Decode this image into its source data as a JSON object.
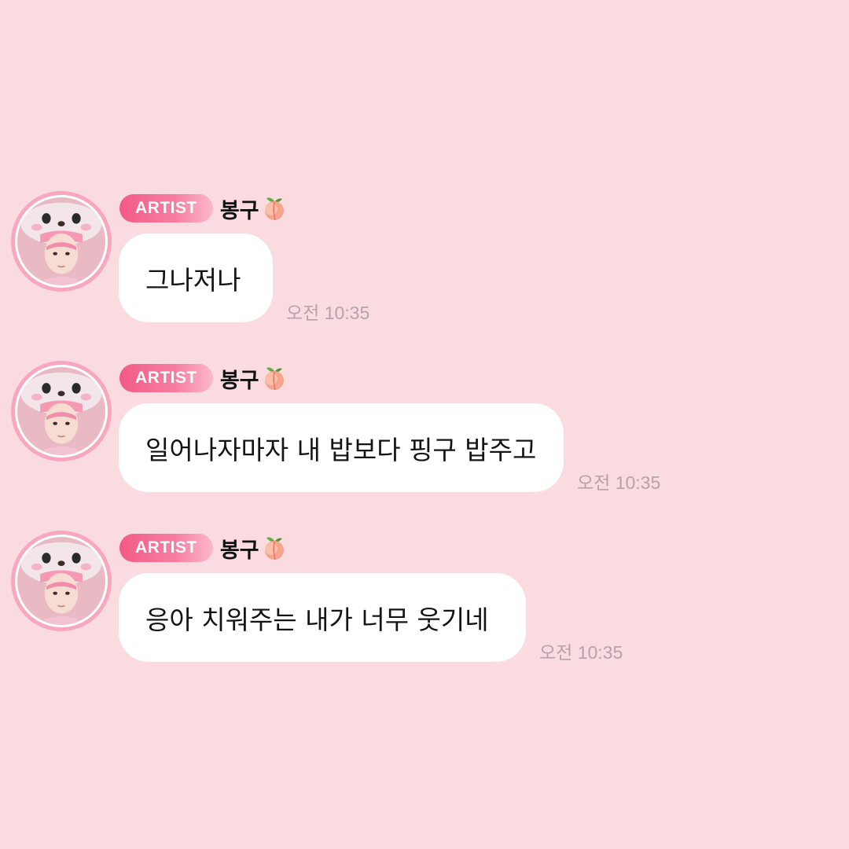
{
  "messages": [
    {
      "badge": "ARTIST",
      "sender": "봉구",
      "sender_icon": "peach-icon",
      "text": "그나저나",
      "time": "오전 10:35",
      "avatar": "artist-avatar"
    },
    {
      "badge": "ARTIST",
      "sender": "봉구",
      "sender_icon": "peach-icon",
      "text": "일어나자마자 내 밥보다 핑구 밥주고",
      "time": "오전 10:35",
      "avatar": "artist-avatar"
    },
    {
      "badge": "ARTIST",
      "sender": "봉구",
      "sender_icon": "peach-icon",
      "text": "응아 치워주는 내가 너무 웃기네",
      "time": "오전 10:35",
      "avatar": "artist-avatar"
    }
  ],
  "colors": {
    "background": "#fadbe0",
    "badge": "#f25b86",
    "bubble": "#ffffff",
    "time": "#b4a3a8"
  }
}
